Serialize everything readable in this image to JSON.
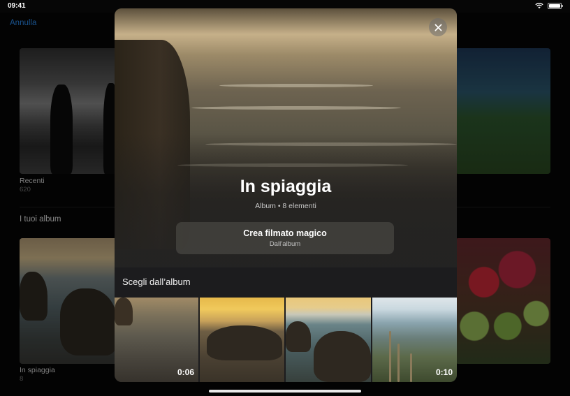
{
  "status_bar": {
    "time": "09:41",
    "battery_level": 1.0
  },
  "nav": {
    "cancel_label": "Annulla"
  },
  "background": {
    "albums": [
      {
        "label": "Recenti",
        "count": "620"
      },
      {
        "label": "In spiaggia",
        "count": "8"
      }
    ],
    "section_title": "I tuoi album"
  },
  "sheet": {
    "title": "In spiaggia",
    "subtitle": "Album • 8 elementi",
    "magic_button": {
      "title": "Crea filmato magico",
      "subtitle": "Dall’album"
    },
    "choose_title": "Scegli dall’album",
    "thumbnails": [
      {
        "duration": "0:06"
      },
      {
        "duration": ""
      },
      {
        "duration": ""
      },
      {
        "duration": "0:10"
      }
    ]
  },
  "icons": [
    "wifi-icon",
    "battery-icon",
    "close-icon"
  ]
}
